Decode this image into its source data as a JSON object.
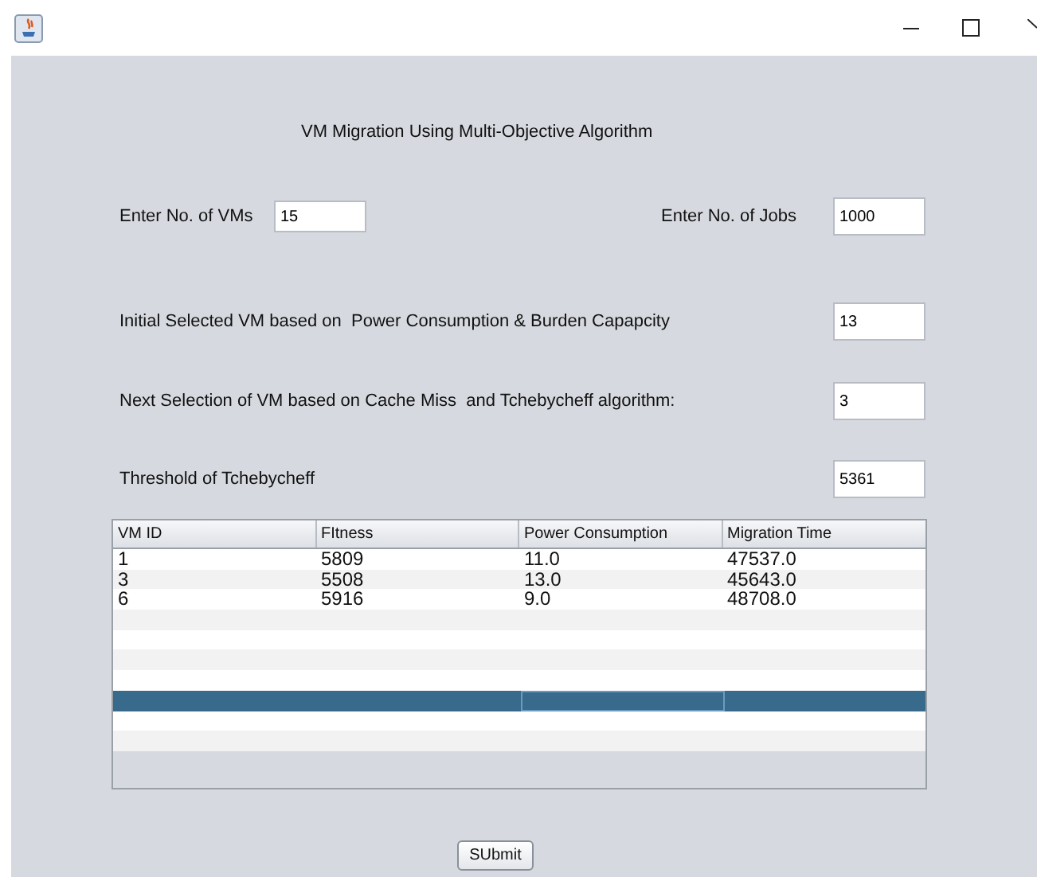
{
  "heading": "VM Migration Using Multi-Objective Algorithm",
  "fields": [
    {
      "label": "Enter No. of VMs",
      "value": "15"
    },
    {
      "label": "Enter No. of Jobs",
      "value": "1000"
    },
    {
      "label": "Initial Selected VM based on  Power Consumption & Burden Capapcity",
      "value": "13"
    },
    {
      "label": "Next Selection of VM based on Cache Miss  and Tchebycheff algorithm:",
      "value": "3"
    },
    {
      "label": "Threshold of Tchebycheff",
      "value": "5361"
    }
  ],
  "table": {
    "columns": [
      "VM ID",
      "FItness",
      "Power Consumption",
      "Migration Time"
    ],
    "rows": [
      [
        "1",
        "5809",
        "11.0",
        "47537.0"
      ],
      [
        "3",
        "5508",
        "13.0",
        "45643.0"
      ],
      [
        "6",
        "5916",
        "9.0",
        "48708.0"
      ]
    ],
    "blank_rows": [
      {
        "selected": false
      },
      {
        "selected": false
      },
      {
        "selected": false
      },
      {
        "selected": false
      },
      {
        "selected": true
      },
      {
        "selected": false
      },
      {
        "selected": false
      }
    ]
  },
  "buttons": [
    "SUbmit"
  ]
}
